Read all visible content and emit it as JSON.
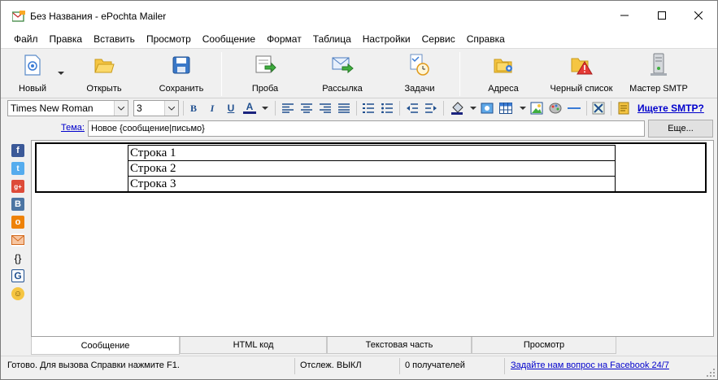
{
  "window": {
    "title": "Без Названия - ePochta Mailer"
  },
  "menu": [
    "Файл",
    "Правка",
    "Вставить",
    "Просмотр",
    "Сообщение",
    "Формат",
    "Таблица",
    "Настройки",
    "Сервис",
    "Справка"
  ],
  "toolbar": {
    "new": "Новый",
    "open": "Открыть",
    "save": "Сохранить",
    "test": "Проба",
    "send": "Рассылка",
    "tasks": "Задачи",
    "addresses": "Адреса",
    "blacklist": "Черный список",
    "smtp_master": "Мастер SMTP"
  },
  "format": {
    "font": "Times New Roman",
    "size": "3",
    "smtp_link": "Ищете SMTP?"
  },
  "subject": {
    "label": "Тема:",
    "value": "Новое {сообщение|письмо}",
    "more_button": "Еще..."
  },
  "social_icons": [
    "facebook-icon",
    "twitter-icon",
    "google-plus-icon",
    "vk-icon",
    "odnoklassniki-icon",
    "mail-icon",
    "braces-icon",
    "google-icon",
    "smiley-icon"
  ],
  "editor": {
    "rows": [
      "Строка 1",
      "Строка 2",
      "Строка 3"
    ]
  },
  "tabs": [
    "Сообщение",
    "HTML код",
    "Текстовая часть",
    "Просмотр"
  ],
  "status": {
    "help": "Готово. Для вызова Справки нажмите F1.",
    "tracking": "Отслеж. ВЫКЛ",
    "recipients": "0 получателей",
    "facebook_link": "Задайте нам вопрос на Facebook 24/7"
  },
  "colors": {
    "link": "#0000cc",
    "facebook": "#3b5998",
    "twitter": "#55acee",
    "google_plus": "#dd4b39",
    "vk": "#4c75a3",
    "odnoklassniki": "#ee8208"
  }
}
